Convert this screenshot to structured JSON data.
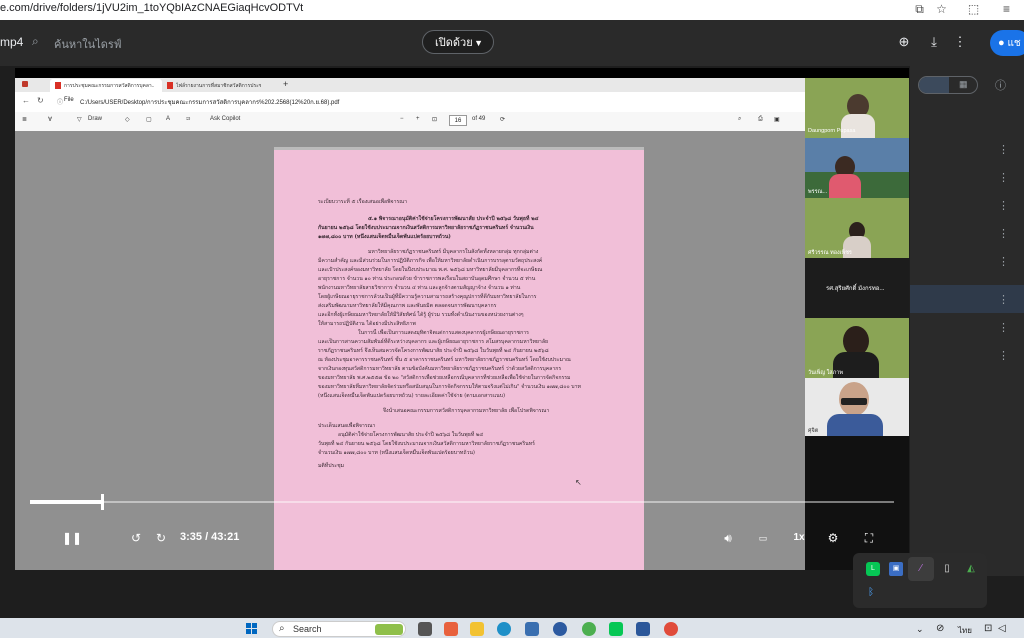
{
  "browser": {
    "url": "e.com/drive/folders/1jVU2im_1toYQbIAzCNAEGiaqHcvODTVt"
  },
  "drive_header": {
    "file_name": "mp4",
    "search_placeholder": "ค้นหาในไดรฟ์",
    "open_with_label": "เปิดด้วย",
    "language_button_label": "แช"
  },
  "video": {
    "edge": {
      "tab1_title": "การประชุมคณะกรรมการสวัสดิการบุคลา...",
      "tab2_title": "ไฟล์รายงานการที่สมาชิกสวัสดิการประชุมคร...",
      "file_label": "File",
      "url": "C:/Users/USER/Desktop/การประชุมคณะกรรมการสวัสดิการบุคลากร%202.2568(12%20ก.ย.68).pdf",
      "draw_label": "Draw",
      "ask_copilot_label": "Ask Copilot",
      "page_current": "16",
      "page_total": "of 49"
    },
    "pdf": {
      "lines": [
        "ระเบียบวาระที่ ๕ เรื่องเสนอเพื่อพิจารณา",
        "๕.๑ พิจารณาอนุมัติค่าใช้จ่ายโครงการพัฒนาสัย ประจำปี ๒๕๖๘ วันพุธที่ ๒๔",
        "กันยายน ๒๕๖๘ โดยใช้งบประมาณจากเงินสวัสดิการมหาวิทยาลัยราชภัฏราชนครินทร์ จำนวนเงิน",
        "๑๗๗,๘๐๐ บาท (หนึ่งแสนเจ็ดหมื่นเจ็ดพันแปดร้อยบาทถ้วน)",
        "มหาวิทยาลัยราชภัฏราชนครินทร์ มีบุคลากรในสังกัดทั้งหลายกลุ่ม ทุกกลุ่มต่าง",
        "มีความสำคัญ และมีส่วนร่วมในการปฏิบัติภารกิจ เพื่อให้มหาวิทยาลัยดำเนินการบรรลุตามวัตถุประสงค์",
        "และเป้าประสงค์ของมหาวิทยาลัย โดยในปีงบประมาณ พ.ศ. ๒๕๖๘ มหาวิทยาลัยมีบุคลากรที่จะเกษียณ",
        "อายุราชการ จำนวน ๑๐ ท่าน ประกอบด้วย ข้าราชการพลเรือนในสถาบันอุดมศึกษา จำนวน ๕ ท่าน",
        "พนักงานมหาวิทยาลัยสายวิชาการ จำนวน ๔ ท่าน และลูกจ้างตามสัญญาจ้าง จำนวน ๑ ท่าน",
        "โดยผู้เกษียณอายุราชการล้วนเป็นผู้ที่มีความรู้ความสามารถสร้างคุณูปการที่ดีกับมหาวิทยาลัยในการ",
        "ส่งเสริมพัฒนามหาวิทยาลัยให้มีคุณภาพ และพันธมิต ตลอดจนการพัฒนาบุคลากร",
        "และอีกทั้งผู้เกษียณมหาวิทยาลัยให้มีวิสัยทัศน์ ได้รู้ ผู้ร่วม รวมทั้งดำเนินงานของหน่วยงานต่างๆ",
        "ให้สามารถปฏิบัติงาน ได้อย่างมีประสิทธิภาพ",
        "ในการนี้ เพื่อเป็นการแสดงมุทิตาจิตแด่การแสดงบุคลากรผู้เกษียณอายุราชการ",
        "และเป็นการสานความสัมพันธ์ที่ดีระหว่างบุคลากร และผู้เกษียณอายุราชการ สโมสรบุคลากรมหาวิทยาลัย",
        "ราชภัฏราชนครินทร์ จึงเห็นสมควรจัดโครงการพัฒนาสัย ประจำปี ๒๕๖๘ ในวันพุธที่ ๒๔ กันยายน ๒๕๖๘",
        "ณ ห้องประชุมอาคารราชนครินทร์ ชั้น ๕ อาคารราชนครินทร์ มหาวิทยาลัยราชภัฏราชนครินทร์ โดยใช้งบประมาณ",
        "จากเงินกองทุนสวัสดิการมหาวิทยาลัย ตามข้อบังคับมหาวิทยาลัยราชภัฏราชนครินทร์ ว่าด้วยสวัสดิการบุคลากร",
        "ของมหาวิทยาลัย พ.ศ.๒๕๕๗ ข้อ ๒๐ \"สวัสดิการเพื่อช่วยเหลือกรณีบุคลากรที่ช่วยเหลือเพื่อใช้จ่ายในการจัดกิจกรรม",
        "ของมหาวิทยาลัยที่มหาวิทยาลัยจัดร่วมหรือสนับสนุนในการจัดกิจกรรมให้ตามจริงแต่ไม่เกิน\" จำนวนเงิน ๑๗๗,๘๐๐ บาท",
        "(หนึ่งแสนเจ็ดหมื่นเจ็ดพันแปดร้อยบาทถ้วน) รายละเอียดค่าใช้จ่าย (ตามเอกสารแนบ)",
        "จึงนำเสนอคณะกรรมการสวัสดิการบุคลากรมหาวิทยาลัย เพื่อโปรดพิจารณา",
        "ประเด็นเสนอเพื่อพิจารณา",
        "อนุมัติค่าใช้จ่ายโครงการพัฒนาสัย ประจำปี ๒๕๖๘ ในวันพุธที่ ๒๔",
        "วันพุธที่ ๒๔ กันยายน ๒๕๖๘ โดยใช้งบประมาณจากเงินสวัสดิการมหาวิทยาลัยราชภัฏราชนครินทร์",
        "จำนวนเงิน ๑๗๗,๘๐๐ บาท (หนึ่งแสนเจ็ดหมื่นเจ็ดพันแปดร้อยบาทถ้วน)",
        "มติที่ประชุม"
      ]
    },
    "participants": [
      {
        "name": "Daungporn Pupasa"
      },
      {
        "name": "พรรณ..."
      },
      {
        "name": "ศรีวรรณ  ทองเพ็ชร"
      },
      {
        "name": "รศ.สุริยศักดิ์ มังกรทอ..."
      },
      {
        "name": "วันเพ็ญ  ใสภาพ"
      },
      {
        "name": "ศุจิต"
      }
    ],
    "player": {
      "current_time": "3:35",
      "duration": "43:21",
      "time_display": "3:35 / 43:21",
      "progress_fraction": 0.083,
      "speed_label": "1x"
    }
  },
  "taskbar": {
    "search_label": "Search",
    "ime_label": "ไทย"
  }
}
